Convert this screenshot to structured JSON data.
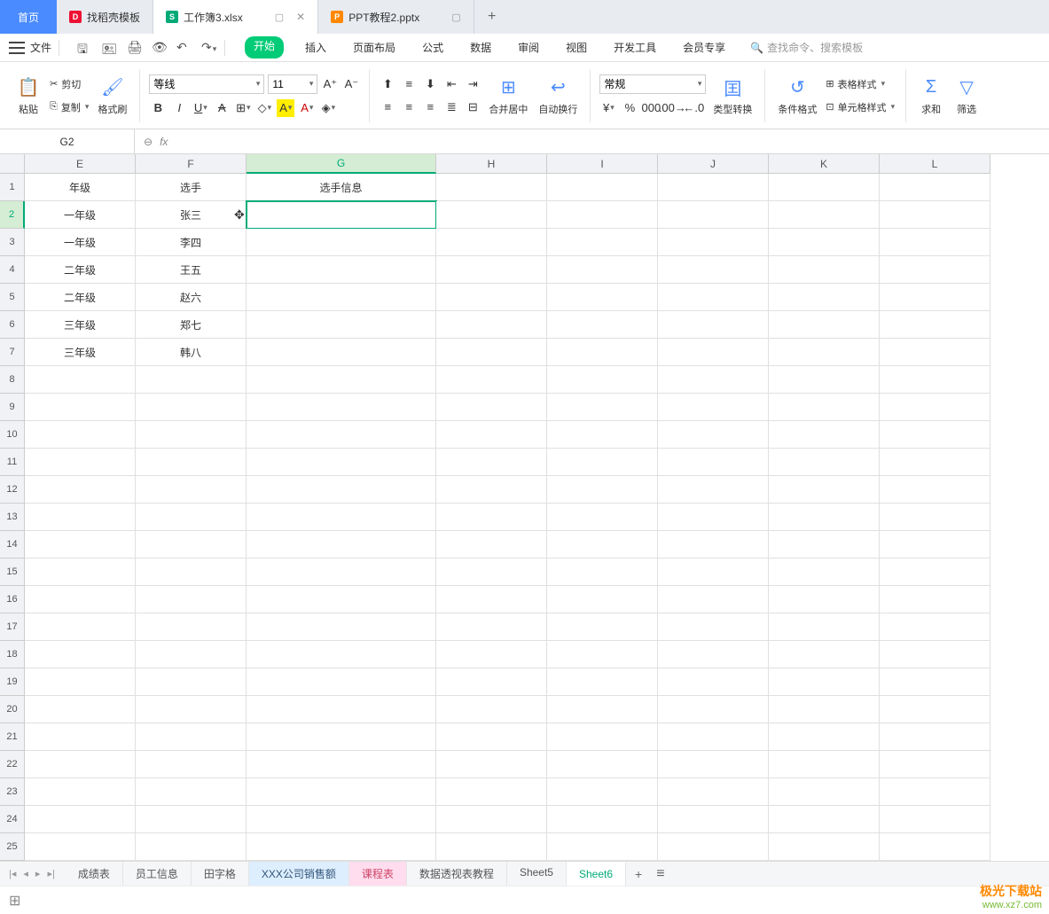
{
  "tabs": {
    "home": "首页",
    "template": "找稻壳模板",
    "workbook": "工作簿3.xlsx",
    "ppt": "PPT教程2.pptx"
  },
  "menu": {
    "file": "文件",
    "items": [
      "开始",
      "插入",
      "页面布局",
      "公式",
      "数据",
      "审阅",
      "视图",
      "开发工具",
      "会员专享"
    ],
    "search_placeholder": "查找命令、搜索模板"
  },
  "ribbon": {
    "paste": "粘贴",
    "cut": "剪切",
    "copy": "复制",
    "format_painter": "格式刷",
    "font_name": "等线",
    "font_size": "11",
    "merge_center": "合并居中",
    "auto_wrap": "自动换行",
    "number_format": "常规",
    "type_convert": "类型转换",
    "cond_format": "条件格式",
    "table_style": "表格样式",
    "cell_style": "单元格样式",
    "sum": "求和",
    "filter": "筛选"
  },
  "formula_bar": {
    "cell_ref": "G2"
  },
  "columns": [
    "E",
    "F",
    "G",
    "H",
    "I",
    "J",
    "K",
    "L"
  ],
  "selected_col": "G",
  "selected_row": 2,
  "row_count": 25,
  "grid": {
    "1": {
      "E": "年级",
      "F": "选手",
      "G": "选手信息"
    },
    "2": {
      "E": "一年级",
      "F": "张三"
    },
    "3": {
      "E": "一年级",
      "F": "李四"
    },
    "4": {
      "E": "二年级",
      "F": "王五"
    },
    "5": {
      "E": "二年级",
      "F": "赵六"
    },
    "6": {
      "E": "三年级",
      "F": "郑七"
    },
    "7": {
      "E": "三年级",
      "F": "韩八"
    }
  },
  "sheets": {
    "items": [
      "成绩表",
      "员工信息",
      "田字格",
      "XXX公司销售额",
      "课程表",
      "数据透视表教程",
      "Sheet5",
      "Sheet6"
    ],
    "active": "Sheet6",
    "highlight_blue": "XXX公司销售额",
    "highlight_orange": "课程表"
  },
  "watermark": {
    "site": "极光下载站",
    "url": "www.xz7.com"
  }
}
